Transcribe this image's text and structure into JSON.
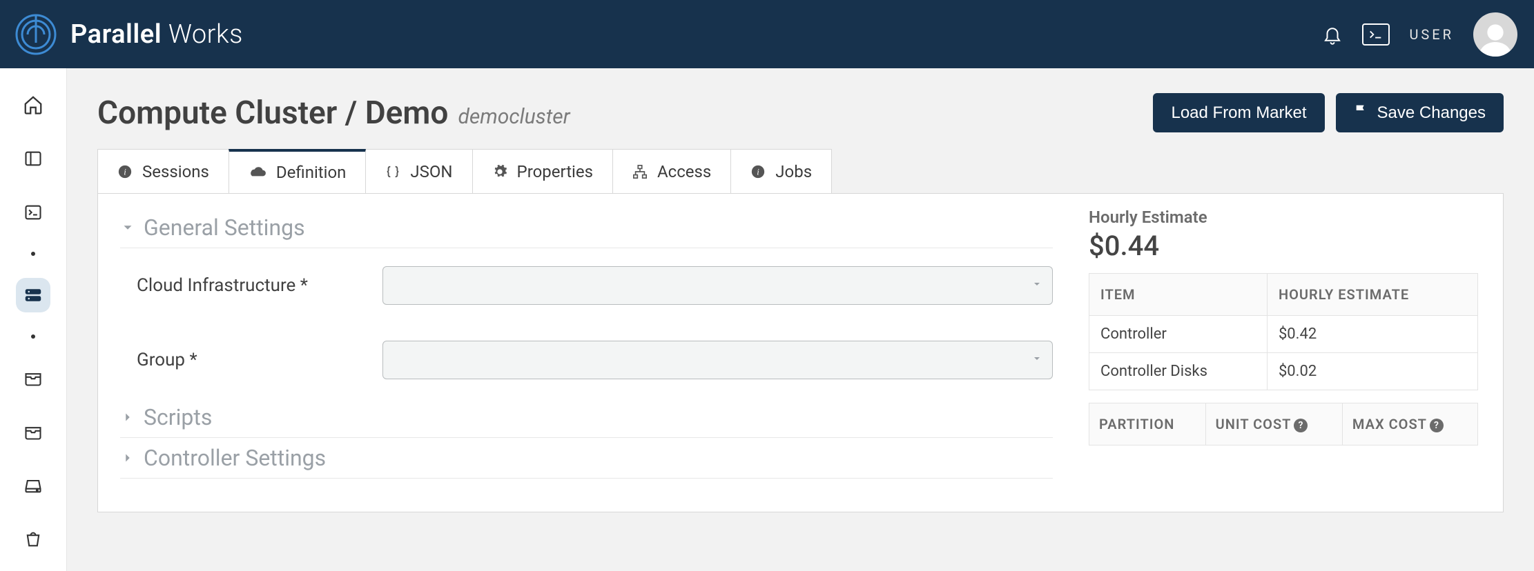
{
  "brand": {
    "name_bold": "Parallel",
    "name_light": "Works"
  },
  "topbar": {
    "user_label": "USER"
  },
  "sidebar": {
    "items": [
      {
        "name": "home"
      },
      {
        "name": "panel"
      },
      {
        "name": "terminal"
      },
      {
        "name": "storage",
        "active": true
      },
      {
        "name": "inbox1"
      },
      {
        "name": "inbox2"
      },
      {
        "name": "drive"
      },
      {
        "name": "bucket"
      }
    ]
  },
  "page": {
    "title": "Compute Cluster / Demo",
    "subtitle": "democluster",
    "actions": {
      "load_market": "Load From Market",
      "save_changes": "Save Changes"
    }
  },
  "tabs": [
    {
      "label": "Sessions",
      "icon": "info"
    },
    {
      "label": "Definition",
      "icon": "cloud",
      "active": true
    },
    {
      "label": "JSON",
      "icon": "braces"
    },
    {
      "label": "Properties",
      "icon": "gear"
    },
    {
      "label": "Access",
      "icon": "sitemap"
    },
    {
      "label": "Jobs",
      "icon": "info"
    }
  ],
  "sections": {
    "general": {
      "title": "General Settings",
      "fields": {
        "cloud_infra_label": "Cloud Infrastructure *",
        "group_label": "Group *"
      }
    },
    "scripts": {
      "title": "Scripts"
    },
    "controller": {
      "title": "Controller Settings"
    }
  },
  "estimate": {
    "label": "Hourly Estimate",
    "value": "$0.44",
    "headers": {
      "item": "ITEM",
      "hourly": "HOURLY ESTIMATE"
    },
    "rows": [
      {
        "item": "Controller",
        "cost": "$0.42"
      },
      {
        "item": "Controller Disks",
        "cost": "$0.02"
      }
    ],
    "headers2": {
      "partition": "PARTITION",
      "unit": "UNIT COST",
      "max": "MAX COST"
    }
  }
}
